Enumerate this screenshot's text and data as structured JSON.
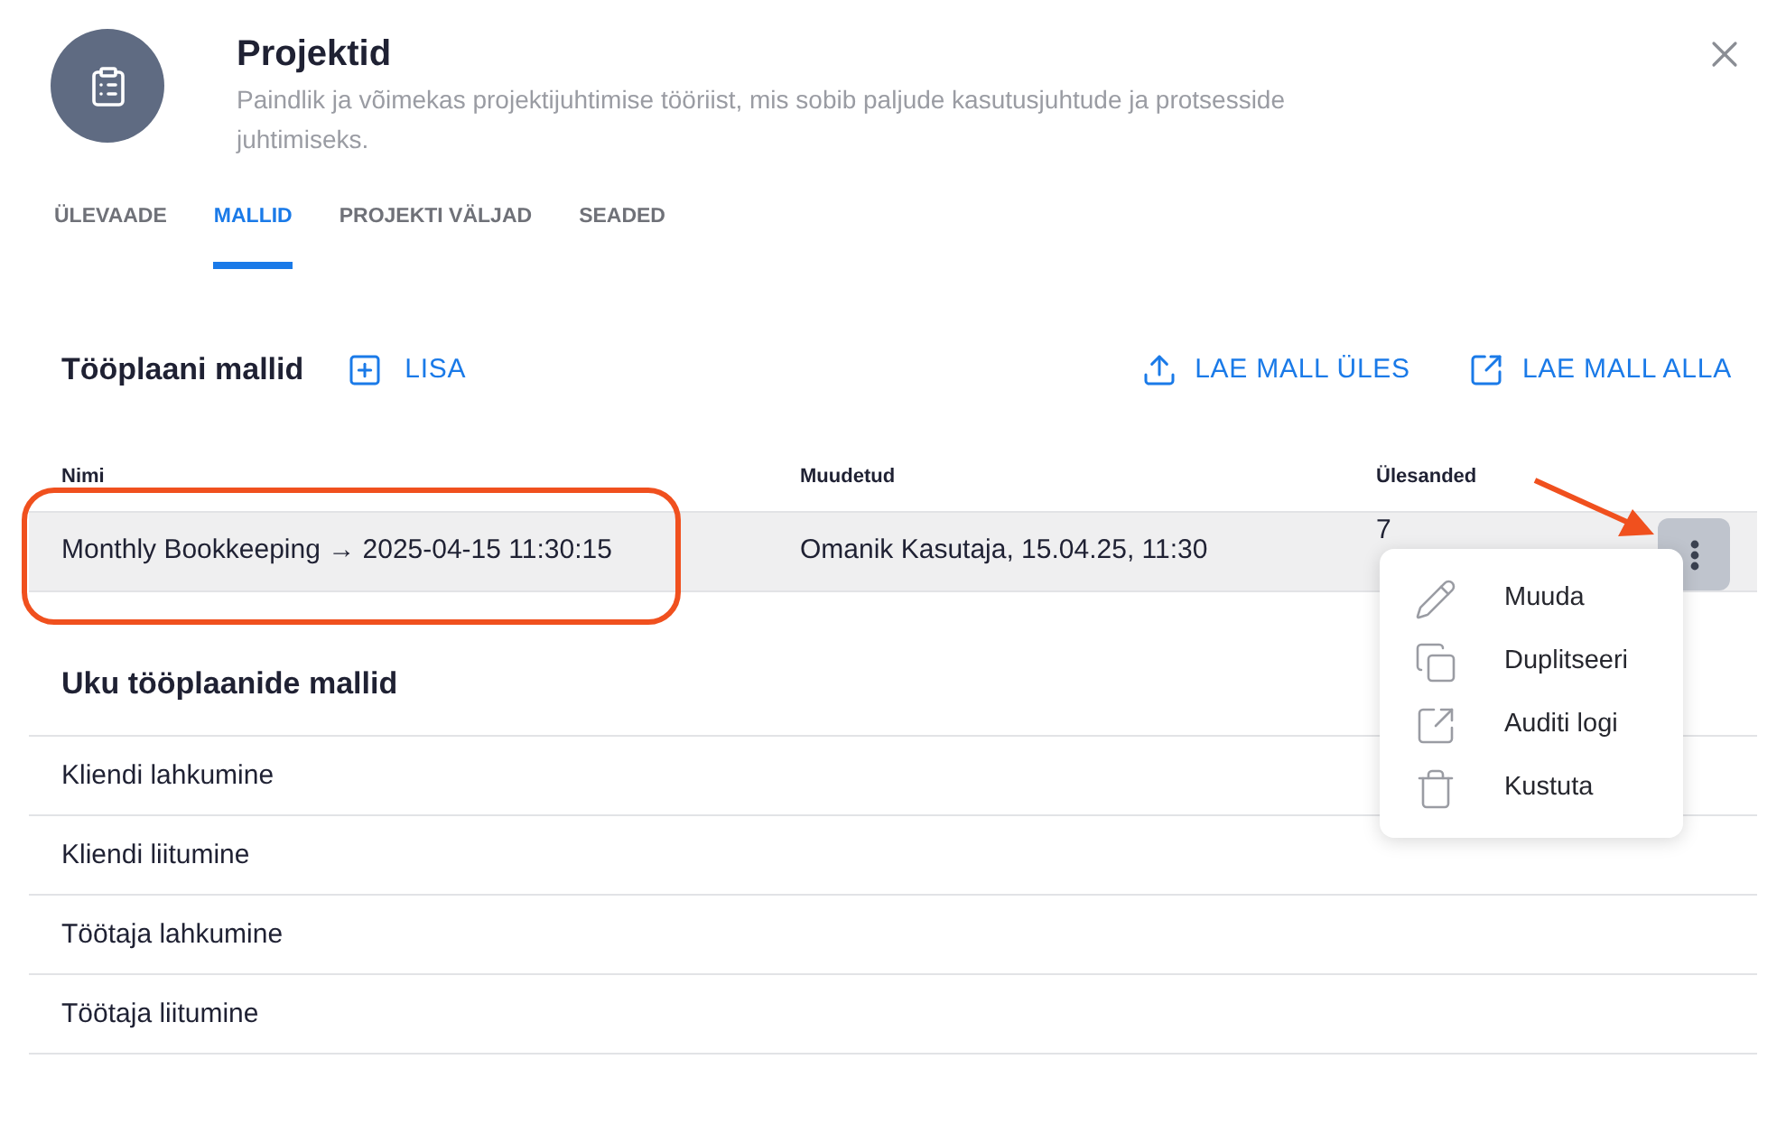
{
  "header": {
    "title": "Projektid",
    "description": "Paindlik ja võimekas projektijuhtimise tööriist, mis sobib paljude kasutusjuhtude ja protsesside juhtimiseks."
  },
  "tabs": [
    {
      "label": "ÜLEVAADE",
      "selected": false
    },
    {
      "label": "MALLID",
      "selected": true
    },
    {
      "label": "PROJEKTI VÄLJAD",
      "selected": false
    },
    {
      "label": "SEADED",
      "selected": false
    }
  ],
  "section": {
    "title": "Tööplaani mallid",
    "add_button": "LISA",
    "upload_button": "LAE MALL ÜLES",
    "download_button": "LAE MALL ALLA"
  },
  "table": {
    "columns": [
      "Nimi",
      "Muudetud",
      "Ülesanded"
    ],
    "rows": [
      {
        "cells": [
          "Monthly Bookkeeping → 2025-04-15 11:30:15",
          "Omanik Kasutaja, 15.04.25, 11:30",
          "7"
        ],
        "highlighted": true
      }
    ]
  },
  "context_menu": {
    "items": [
      {
        "kind": "edit",
        "label": "Muuda"
      },
      {
        "kind": "copy",
        "label": "Duplitseeri"
      },
      {
        "kind": "external",
        "label": "Auditi logi"
      },
      {
        "kind": "delete",
        "label": "Kustuta"
      }
    ]
  },
  "default_section": {
    "title": "Uku tööplaanide mallid",
    "items": [
      "Kliendi lahkumine",
      "Kliendi liitumine",
      "Töötaja lahkumine",
      "Töötaja liitumine"
    ]
  }
}
